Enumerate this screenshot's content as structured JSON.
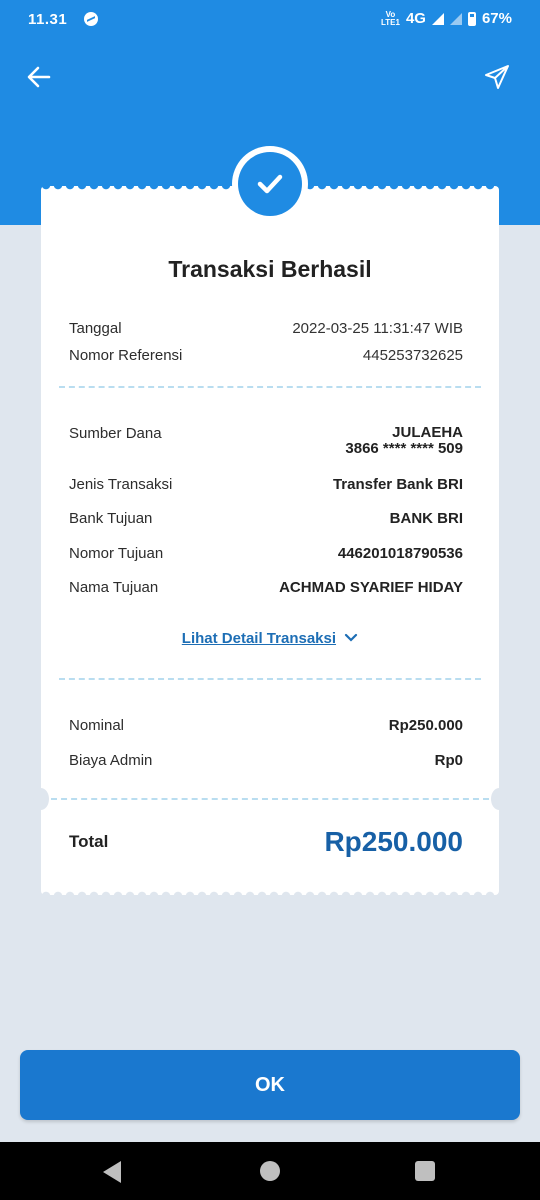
{
  "status_bar": {
    "time": "11.31",
    "volte": "Vo\nLTE1",
    "network": "4G",
    "battery": "67%"
  },
  "toolbar": {
    "back_icon": "arrow-left-icon",
    "share_icon": "send-icon"
  },
  "receipt": {
    "title": "Transaksi Berhasil",
    "tanggal_label": "Tanggal",
    "tanggal_value": "2022-03-25 11:31:47 WIB",
    "referensi_label": "Nomor Referensi",
    "referensi_value": "445253732625",
    "sumber_label": "Sumber Dana",
    "sumber_name": "JULAEHA",
    "sumber_account": "3866 **** **** 509",
    "jenis_label": "Jenis Transaksi",
    "jenis_value": "Transfer Bank BRI",
    "bank_label": "Bank Tujuan",
    "bank_value": "BANK BRI",
    "nomor_tujuan_label": "Nomor Tujuan",
    "nomor_tujuan_value": "446201018790536",
    "nama_tujuan_label": "Nama Tujuan",
    "nama_tujuan_value": "ACHMAD SYARIEF HIDAY",
    "detail_link": "Lihat Detail Transaksi",
    "nominal_label": "Nominal",
    "nominal_value": "Rp250.000",
    "admin_label": "Biaya Admin",
    "admin_value": "Rp0",
    "total_label": "Total",
    "total_value": "Rp250.000"
  },
  "ok_button": "OK",
  "colors": {
    "primary": "#1f8be3",
    "button": "#1a78cf",
    "total": "#1760a6",
    "link": "#1d6eb5",
    "background": "#dfe6ee"
  }
}
